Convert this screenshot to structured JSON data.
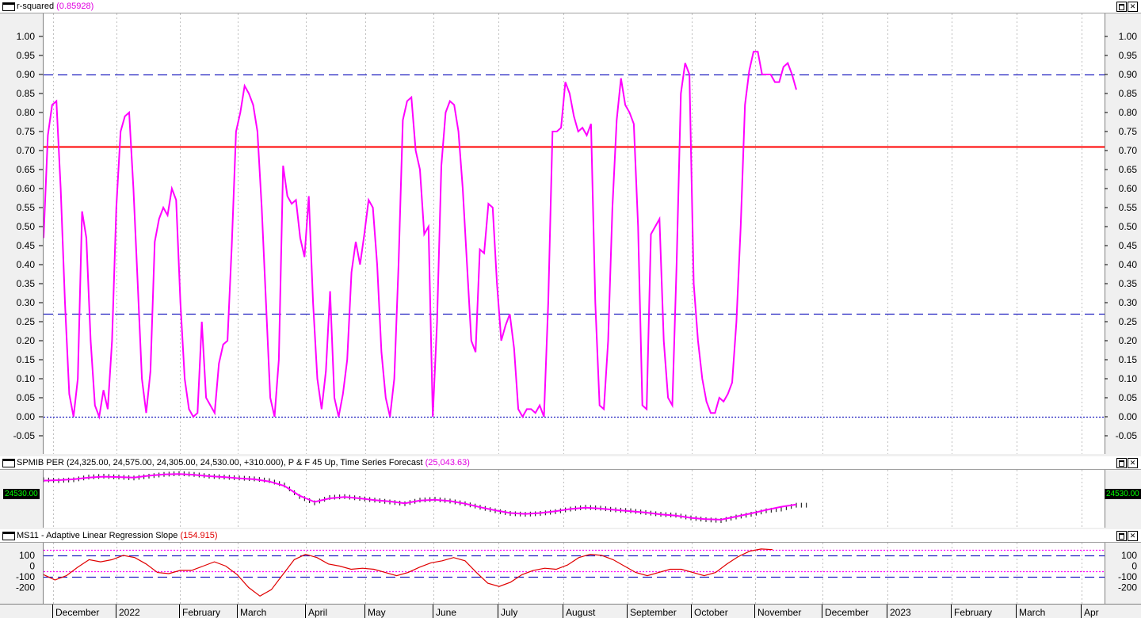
{
  "panes": {
    "rsq": {
      "title": "r-squared",
      "value": "(0.85928)",
      "y_ticks": [
        "1.00",
        "0.95",
        "0.90",
        "0.85",
        "0.80",
        "0.75",
        "0.70",
        "0.65",
        "0.60",
        "0.55",
        "0.50",
        "0.45",
        "0.40",
        "0.35",
        "0.30",
        "0.25",
        "0.20",
        "0.15",
        "0.10",
        "0.05",
        "0.00",
        "-0.05"
      ],
      "max_icon": "maximize-icon",
      "close_icon": "close-icon",
      "close_glyph": "✕"
    },
    "price": {
      "title": "SPMIB PER",
      "ohlc": "(24,325.00, 24,575.00, 24,305.00, 24,530.00, +310.000)",
      "indicator": ", P & F 45 Up, Time Series Forecast",
      "indicator_value": "(25,043.63)",
      "last_price_left": "24530.00",
      "last_price_right": "24530.00",
      "close_glyph": "✕"
    },
    "slope": {
      "title": "MS11 - Adaptive Linear Regression Slope",
      "value": "(154.915)",
      "y_ticks": [
        "100",
        "0",
        "-100",
        "-200"
      ],
      "close_glyph": "✕"
    }
  },
  "date_axis": {
    "labels": [
      "December",
      "2022",
      "February",
      "March",
      "April",
      "May",
      "June",
      "July",
      "August",
      "September",
      "October",
      "November",
      "December",
      "2023",
      "February",
      "March",
      "Apr"
    ]
  },
  "colors": {
    "rsq_line": "#ff00ff",
    "red_level": "#ff0000",
    "blue_dash": "#2020c0",
    "price_bars": "#000000",
    "forecast_line": "#ff00ff",
    "slope_line": "#e00000"
  },
  "chart_data": [
    {
      "type": "line",
      "title": "r-squared",
      "ylim": [
        -0.08,
        1.03
      ],
      "reference_lines": [
        {
          "value": 0.9,
          "style": "dashed",
          "color": "#2020c0"
        },
        {
          "value": 0.71,
          "style": "solid",
          "color": "#ff0000"
        },
        {
          "value": 0.27,
          "style": "dashed",
          "color": "#2020c0"
        },
        {
          "value": 0.0,
          "style": "dotted",
          "color": "#2020c0"
        }
      ],
      "series": [
        {
          "values": [
            0.47,
            0.74,
            0.82,
            0.83,
            0.6,
            0.3,
            0.06,
            0.0,
            0.1,
            0.54,
            0.47,
            0.2,
            0.03,
            0.0,
            0.07,
            0.02,
            0.2,
            0.55,
            0.75,
            0.79,
            0.8,
            0.6,
            0.35,
            0.1,
            0.01,
            0.12,
            0.46,
            0.52,
            0.55,
            0.53,
            0.6,
            0.57,
            0.3,
            0.1,
            0.02,
            0.0,
            0.01,
            0.25,
            0.05,
            0.03,
            0.01,
            0.14,
            0.19,
            0.2,
            0.45,
            0.75,
            0.8,
            0.87,
            0.85,
            0.82,
            0.75,
            0.55,
            0.3,
            0.05,
            0.0,
            0.15,
            0.66,
            0.58,
            0.56,
            0.57,
            0.47,
            0.42,
            0.58,
            0.3,
            0.1,
            0.02,
            0.12,
            0.33,
            0.05,
            0.0,
            0.06,
            0.15,
            0.38,
            0.46,
            0.4,
            0.48,
            0.57,
            0.55,
            0.4,
            0.17,
            0.05,
            0.0,
            0.1,
            0.4,
            0.78,
            0.83,
            0.84,
            0.7,
            0.65,
            0.48,
            0.5,
            0.0,
            0.25,
            0.66,
            0.8,
            0.83,
            0.82,
            0.75,
            0.6,
            0.4,
            0.2,
            0.17,
            0.44,
            0.43,
            0.56,
            0.55,
            0.35,
            0.2,
            0.24,
            0.27,
            0.18,
            0.02,
            0.0,
            0.02,
            0.02,
            0.01,
            0.03,
            0.0,
            0.3,
            0.75,
            0.75,
            0.76,
            0.88,
            0.85,
            0.79,
            0.75,
            0.76,
            0.74,
            0.77,
            0.3,
            0.03,
            0.02,
            0.2,
            0.55,
            0.78,
            0.89,
            0.82,
            0.8,
            0.77,
            0.5,
            0.03,
            0.02,
            0.48,
            0.5,
            0.52,
            0.2,
            0.05,
            0.03,
            0.4,
            0.85,
            0.93,
            0.9,
            0.35,
            0.2,
            0.1,
            0.04,
            0.01,
            0.01,
            0.05,
            0.04,
            0.06,
            0.09,
            0.25,
            0.5,
            0.82,
            0.91,
            0.96,
            0.96,
            0.9,
            0.9,
            0.9,
            0.88,
            0.88,
            0.92,
            0.93,
            0.9,
            0.86
          ]
        }
      ]
    },
    {
      "type": "line",
      "title": "SPMIB PER",
      "ylim": [
        20000,
        29000
      ],
      "series": [
        {
          "name": "SPMIB PER",
          "values": [
            27400,
            27300,
            27400,
            27700,
            27800,
            27700,
            27600,
            27800,
            28000,
            28100,
            28000,
            27800,
            27700,
            27600,
            27500,
            27300,
            26800,
            25500,
            24800,
            25400,
            25500,
            25300,
            25100,
            24900,
            24700,
            25100,
            25200,
            25000,
            24700,
            24300,
            23900,
            23600,
            23500,
            23600,
            23800,
            24100,
            24300,
            24200,
            24000,
            23900,
            23700,
            23500,
            23400,
            23100,
            22900,
            22800,
            23200,
            23500,
            23900,
            24100,
            24530
          ]
        },
        {
          "name": "Time Series Forecast",
          "values": [
            27300,
            27350,
            27450,
            27650,
            27750,
            27700,
            27650,
            27850,
            28000,
            28050,
            27950,
            27800,
            27700,
            27550,
            27450,
            27200,
            26700,
            25600,
            24900,
            25300,
            25450,
            25300,
            25100,
            24950,
            24750,
            25050,
            25150,
            25000,
            24700,
            24300,
            23950,
            23650,
            23550,
            23650,
            23850,
            24100,
            24250,
            24150,
            24000,
            23850,
            23700,
            23500,
            23350,
            23100,
            22950,
            22900,
            23250,
            23600,
            24000,
            24350,
            24600
          ]
        }
      ]
    },
    {
      "type": "line",
      "title": "MS11 - Adaptive Linear Regression Slope",
      "ylim": [
        -290,
        180
      ],
      "reference_lines": [
        {
          "value": 150,
          "style": "dotted",
          "color": "#ff00ff"
        },
        {
          "value": 100,
          "style": "dashed",
          "color": "#2020c0"
        },
        {
          "value": -50,
          "style": "dotted",
          "color": "#ff00ff"
        },
        {
          "value": -100,
          "style": "dashed",
          "color": "#2020c0"
        }
      ],
      "series": [
        {
          "values": [
            -80,
            -130,
            -90,
            -10,
            60,
            40,
            60,
            100,
            80,
            20,
            -60,
            -70,
            -40,
            -40,
            0,
            40,
            0,
            -80,
            -200,
            -280,
            -220,
            -80,
            60,
            110,
            80,
            20,
            0,
            -30,
            -20,
            -30,
            -60,
            -90,
            -60,
            -10,
            30,
            50,
            80,
            50,
            -60,
            -160,
            -190,
            -150,
            -80,
            -40,
            -20,
            -30,
            10,
            80,
            110,
            100,
            60,
            0,
            -60,
            -90,
            -60,
            -30,
            -30,
            -60,
            -90,
            -60,
            20,
            90,
            140,
            160,
            154
          ]
        }
      ]
    }
  ]
}
